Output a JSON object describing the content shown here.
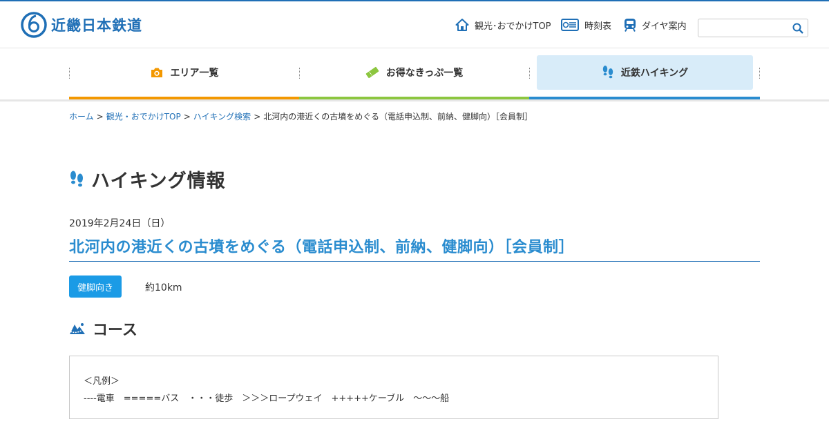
{
  "brand": {
    "name": "近畿日本鉄道",
    "color": "#1f6fb6"
  },
  "header_nav": [
    {
      "label": "観光･おでかけTOP",
      "icon": "home-icon"
    },
    {
      "label": "時刻表",
      "icon": "timetable-icon"
    },
    {
      "label": "ダイヤ案内",
      "icon": "train-icon"
    }
  ],
  "search": {
    "placeholder": "",
    "icon": "search-icon"
  },
  "global_nav": [
    {
      "label": "エリア一覧",
      "icon": "camera-icon",
      "accent": "#f39800"
    },
    {
      "label": "お得なきっぷ一覧",
      "icon": "ticket-icon",
      "accent": "#8cc63f"
    },
    {
      "label": "近鉄ハイキング",
      "icon": "footprints-icon",
      "accent": "#2a8ccf",
      "active": true
    }
  ],
  "breadcrumb": {
    "items": [
      "ホーム",
      "観光・おでかけTOP",
      "ハイキング検索"
    ],
    "separator": ">",
    "current": "北河内の港近くの古墳をめぐる（電話申込制、前納、健脚向）［会員制］"
  },
  "page": {
    "heading": "ハイキング情報",
    "date": "2019年2月24日（日）",
    "event_title": "北河内の港近くの古墳をめぐる（電話申込制、前納、健脚向）［会員制］",
    "badge": "健脚向き",
    "distance": "約10km",
    "course_heading": "コース"
  },
  "legend": {
    "title": "＜凡例＞",
    "items": "----電車　=====バス　・・・徒歩　＞＞＞ロープウェイ　+++++ケーブル　〜〜〜船"
  },
  "colors": {
    "accent_blue": "#2a8ccf",
    "badge_blue": "#1b9be6",
    "orange": "#f39800",
    "green": "#8cc63f",
    "active_bg": "#d8ecf9"
  }
}
